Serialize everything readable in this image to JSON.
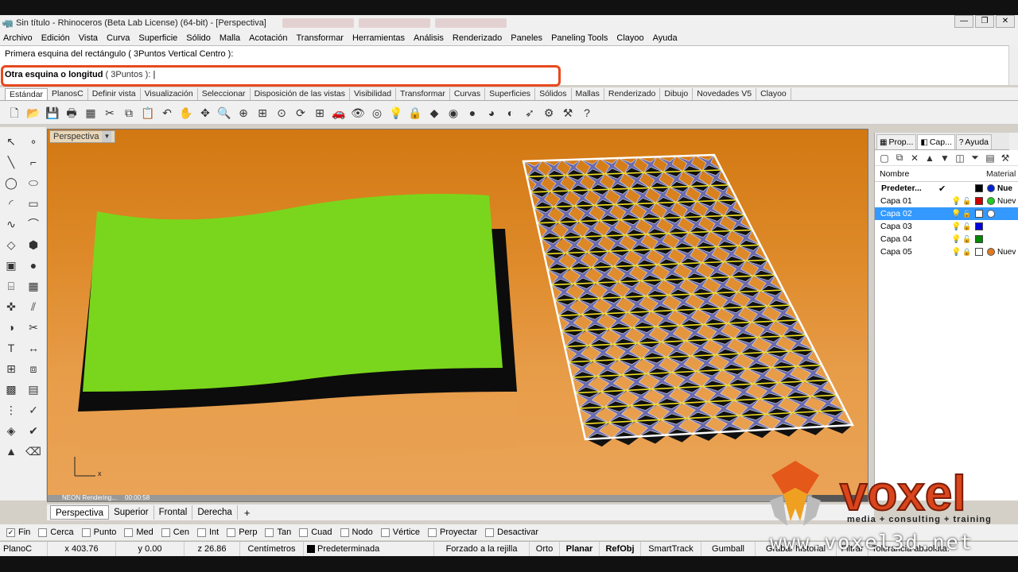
{
  "window": {
    "title": "Sin título - Rhinoceros (Beta Lab License) (64-bit) - [Perspectiva]"
  },
  "menu": [
    "Archivo",
    "Edición",
    "Vista",
    "Curva",
    "Superficie",
    "Sólido",
    "Malla",
    "Acotación",
    "Transformar",
    "Herramientas",
    "Análisis",
    "Renderizado",
    "Paneles",
    "Paneling Tools",
    "Clayoo",
    "Ayuda"
  ],
  "command": {
    "history": "Primera esquina del rectángulo ( 3Puntos  Vertical  Centro ):",
    "prompt_label": "Otra esquina o longitud",
    "prompt_options": "( 3Puntos ):",
    "cursor": "|"
  },
  "toolbar_tabs": [
    "Estándar",
    "PlanosC",
    "Definir vista",
    "Visualización",
    "Seleccionar",
    "Disposición de las vistas",
    "Visibilidad",
    "Transformar",
    "Curvas",
    "Superficies",
    "Sólidos",
    "Mallas",
    "Renderizado",
    "Dibujo",
    "Novedades V5",
    "Clayoo"
  ],
  "main_toolbar_icons": [
    "new-file-icon",
    "open-file-icon",
    "save-icon",
    "print-icon",
    "properties-icon",
    "cut-icon",
    "copy-icon",
    "paste-icon",
    "undo-icon",
    "pan-icon",
    "rotate-view-icon",
    "zoom-icon",
    "zoom-window-icon",
    "zoom-extents-icon",
    "zoom-selected-icon",
    "rotate-icon",
    "four-views-icon",
    "car-icon",
    "hide-icon",
    "show-icon",
    "light-icon",
    "lock-icon",
    "layer-icon",
    "color-wheel-icon",
    "sphere-icon",
    "render-icon",
    "material-icon",
    "snap-icon",
    "gear-icon",
    "options-icon",
    "help-icon"
  ],
  "left_tools_icons": [
    "select-icon",
    "point-icon",
    "line-icon",
    "polyline-icon",
    "circle-icon",
    "ellipse-icon",
    "arc-icon",
    "rectangle-icon",
    "curve-icon",
    "fillet-icon",
    "surface-icon",
    "solid-icon",
    "box-icon",
    "sphere-tool-icon",
    "cylinder-icon",
    "mesh-icon",
    "transform-icon",
    "split-icon",
    "boolean-icon",
    "trim-icon",
    "text-icon",
    "dimension-icon",
    "array-icon",
    "group-icon",
    "blocks-icon",
    "layout-icon",
    "grid-icon",
    "analyze-icon",
    "render-tool-icon",
    "check-icon",
    "paint-icon",
    "erase-icon"
  ],
  "viewport": {
    "title": "Perspectiva",
    "render_label": "NEON Rendering...",
    "render_time": "00:00:58",
    "render_progress": 0.93,
    "axis_x": "x"
  },
  "viewport_tabs": [
    "Perspectiva",
    "Superior",
    "Frontal",
    "Derecha"
  ],
  "viewport_tab_add": "+",
  "osnaps": [
    {
      "label": "Fin",
      "checked": true
    },
    {
      "label": "Cerca",
      "checked": false
    },
    {
      "label": "Punto",
      "checked": false
    },
    {
      "label": "Med",
      "checked": false
    },
    {
      "label": "Cen",
      "checked": false
    },
    {
      "label": "Int",
      "checked": false
    },
    {
      "label": "Perp",
      "checked": false
    },
    {
      "label": "Tan",
      "checked": false
    },
    {
      "label": "Cuad",
      "checked": false
    },
    {
      "label": "Nodo",
      "checked": false
    },
    {
      "label": "Vértice",
      "checked": false
    },
    {
      "label": "Proyectar",
      "checked": false
    },
    {
      "label": "Desactivar",
      "checked": false
    }
  ],
  "status": {
    "cplane": "PlanoC",
    "x": "x 403.76",
    "y": "y 0.00",
    "z": "z 26.86",
    "units": "Centímetros",
    "layer": "Predeterminada",
    "grid_snap": "Forzado a la rejilla",
    "ortho": "Orto",
    "planar": "Planar",
    "osnap": "RefObj",
    "smarttrack": "SmartTrack",
    "gumball": "Gumball",
    "history": "Grabar historial",
    "filter": "Filtrar",
    "tolerance": "Tolerancia absoluta: 0.01"
  },
  "panel": {
    "tabs": [
      {
        "label": "Prop...",
        "icon": "properties-icon"
      },
      {
        "label": "Cap...",
        "icon": "layers-icon"
      },
      {
        "label": "Ayuda",
        "icon": "help-icon"
      }
    ],
    "col_name": "Nombre",
    "col_material": "Material",
    "layers": [
      {
        "name": "Predeter...",
        "current": true,
        "color": "#000000",
        "material_color": "#0022cc",
        "material_name": "Nue",
        "bold": true
      },
      {
        "name": "Capa 01",
        "current": false,
        "color": "#cc0000",
        "material_color": "#22cc22",
        "material_name": "Nuev"
      },
      {
        "name": "Capa 02",
        "current": false,
        "color": "#ffffff",
        "material_color": "#ffffff",
        "material_name": "",
        "selected": true
      },
      {
        "name": "Capa 03",
        "current": false,
        "color": "#0000dd",
        "material_color": "",
        "material_name": ""
      },
      {
        "name": "Capa 04",
        "current": false,
        "color": "#008800",
        "material_color": "",
        "material_name": ""
      },
      {
        "name": "Capa 05",
        "current": false,
        "color": "#ffffff",
        "material_color": "#e07a1f",
        "material_name": "Nuev"
      }
    ]
  },
  "watermark": {
    "brand": "voxel",
    "tagline": "media + consulting + training",
    "url": "www.voxel3d.net"
  },
  "colors": {
    "prompt_highlight": "#e8491e",
    "surface_green": "#7ad61c",
    "selection_blue": "#3399ff"
  }
}
